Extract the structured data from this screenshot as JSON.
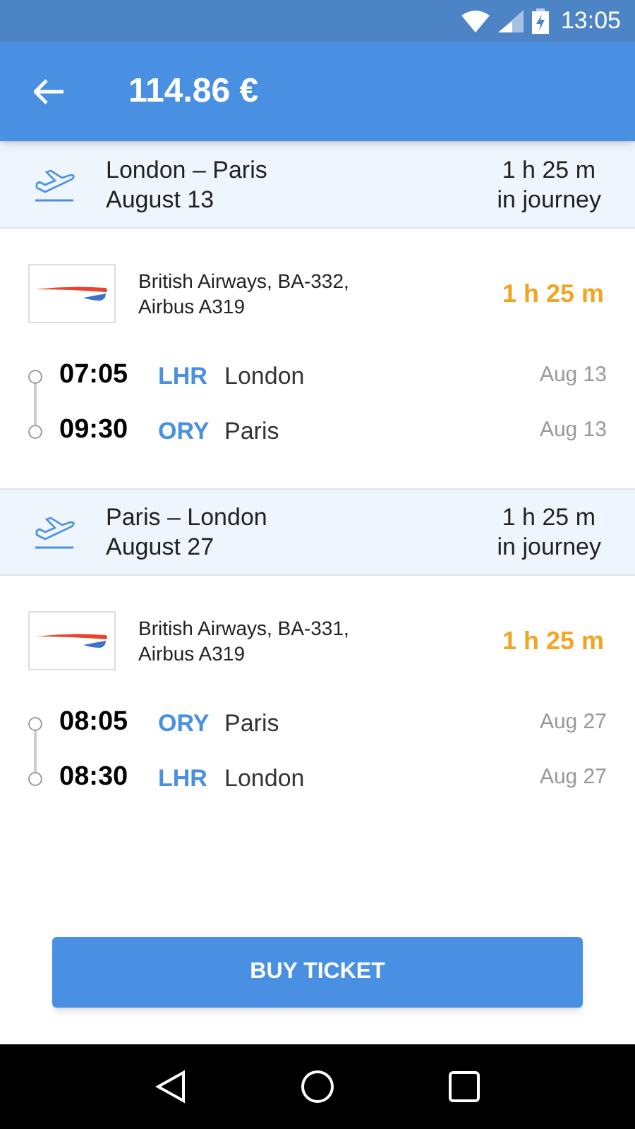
{
  "status_bar": {
    "time": "13:05"
  },
  "app_bar": {
    "title": "114.86 €"
  },
  "legs": [
    {
      "route": "London – Paris",
      "date": "August 13",
      "duration": "1 h 25 m",
      "duration_note": "in journey",
      "flight_lines": [
        "British Airways, BA-332,",
        "Airbus A319"
      ],
      "flight_duration": "1 h 25 m",
      "stops": [
        {
          "time": "07:05",
          "code": "LHR",
          "city": "London",
          "date": "Aug 13"
        },
        {
          "time": "09:30",
          "code": "ORY",
          "city": "Paris",
          "date": "Aug 13"
        }
      ]
    },
    {
      "route": "Paris – London",
      "date": "August 27",
      "duration": "1 h 25 m",
      "duration_note": "in journey",
      "flight_lines": [
        "British Airways, BA-331,",
        "Airbus A319"
      ],
      "flight_duration": "1 h 25 m",
      "stops": [
        {
          "time": "08:05",
          "code": "ORY",
          "city": "Paris",
          "date": "Aug 27"
        },
        {
          "time": "08:30",
          "code": "LHR",
          "city": "London",
          "date": "Aug 27"
        }
      ]
    }
  ],
  "buy_button": "BUY TICKET"
}
